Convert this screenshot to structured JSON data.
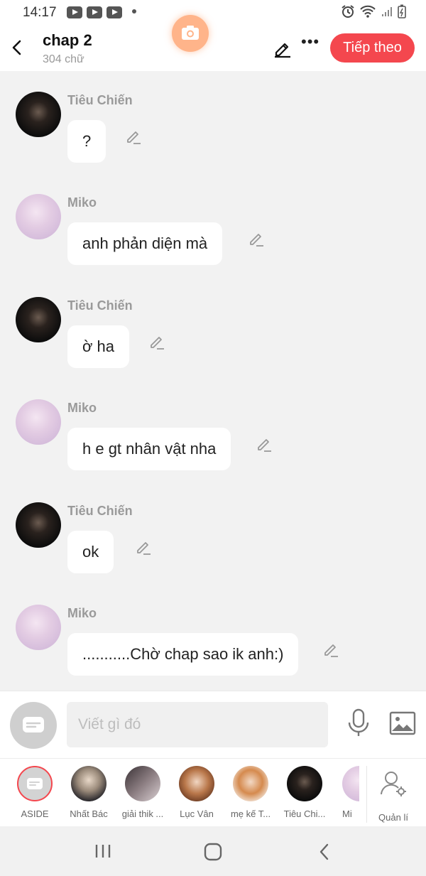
{
  "status_bar": {
    "time": "14:17"
  },
  "header": {
    "title": "chap 2",
    "subtitle": "304 chữ",
    "next_label": "Tiếp theo"
  },
  "messages": [
    {
      "name": "Tiêu Chiến",
      "text": "?",
      "avatar": "dark"
    },
    {
      "name": "Miko",
      "text": "anh phản diện mà",
      "avatar": "pink"
    },
    {
      "name": "Tiêu Chiến",
      "text": "ờ ha",
      "avatar": "dark"
    },
    {
      "name": "Miko",
      "text": "h e gt nhân vật nha",
      "avatar": "pink"
    },
    {
      "name": "Tiêu Chiến",
      "text": "ok",
      "avatar": "dark"
    },
    {
      "name": "Miko",
      "text": "...........Chờ chap sao ik anh:)",
      "avatar": "pink"
    }
  ],
  "composer": {
    "placeholder": "Viết gì đó"
  },
  "characters": [
    {
      "label": "ASIDE"
    },
    {
      "label": "Nhất Bác"
    },
    {
      "label": "giải thik ..."
    },
    {
      "label": "Lục Vân"
    },
    {
      "label": "mẹ kế T..."
    },
    {
      "label": "Tiêu Chi..."
    },
    {
      "label": "Mi"
    },
    {
      "label": "Quản lí"
    }
  ],
  "colors": {
    "accent": "#f4474e",
    "camera": "#ffb48a",
    "background": "#f2f2f2"
  }
}
